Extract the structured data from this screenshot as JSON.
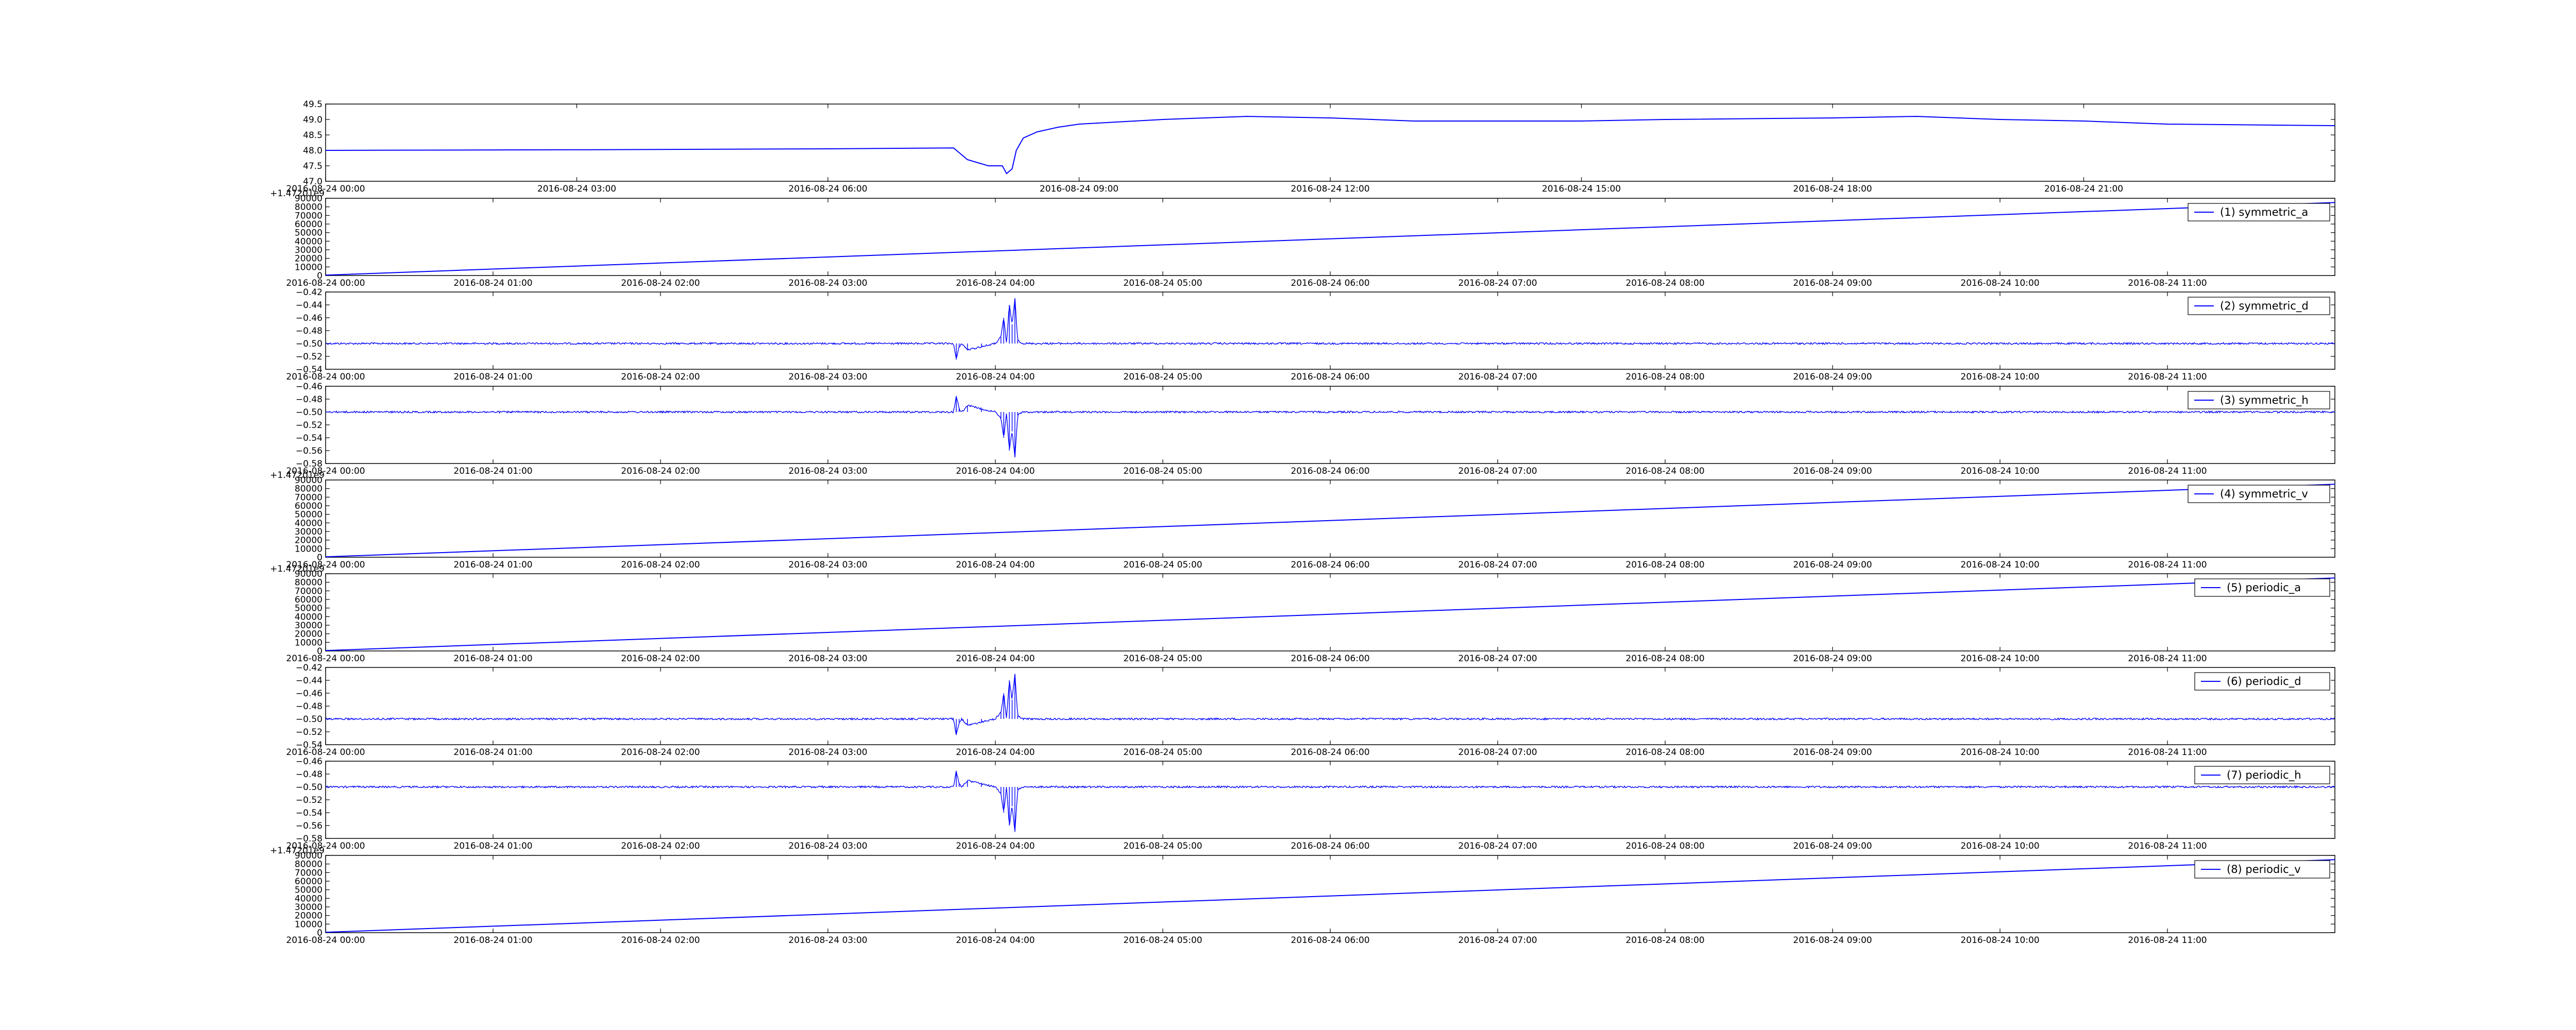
{
  "figure": {
    "background": "#ffffff",
    "line_color": "#0000ff"
  },
  "chart_data": [
    {
      "type": "line",
      "title": "",
      "xlabel": "",
      "ylabel": "",
      "x_range": [
        "2016-08-24 00:00",
        "2016-08-25 00:00"
      ],
      "ylim": [
        47.0,
        49.5
      ],
      "grid": false,
      "x_ticks": [
        "2016-08-24 00:00",
        "2016-08-24 03:00",
        "2016-08-24 06:00",
        "2016-08-24 09:00",
        "2016-08-24 12:00",
        "2016-08-24 15:00",
        "2016-08-24 18:00",
        "2016-08-24 21:00"
      ],
      "y_ticks": [
        "47.0",
        "47.5",
        "48.0",
        "48.5",
        "49.0",
        "49.5"
      ],
      "series": [
        {
          "color": "#0000ff",
          "x": [
            "2016-08-24 00:00",
            "2016-08-24 03:00",
            "2016-08-24 06:00",
            "2016-08-24 07:30",
            "2016-08-24 07:40",
            "2016-08-24 07:55",
            "2016-08-24 08:05",
            "2016-08-24 08:08",
            "2016-08-24 08:12",
            "2016-08-24 08:15",
            "2016-08-24 08:20",
            "2016-08-24 08:30",
            "2016-08-24 08:45",
            "2016-08-24 09:00",
            "2016-08-24 10:00",
            "2016-08-24 11:00",
            "2016-08-24 12:00",
            "2016-08-24 13:00",
            "2016-08-24 15:00",
            "2016-08-24 16:00",
            "2016-08-24 18:00",
            "2016-08-24 19:00",
            "2016-08-24 20:00",
            "2016-08-24 21:00",
            "2016-08-24 22:00",
            "2016-08-25 00:00"
          ],
          "y": [
            48.0,
            48.02,
            48.05,
            48.08,
            47.7,
            47.5,
            47.5,
            47.25,
            47.4,
            48.0,
            48.4,
            48.6,
            48.75,
            48.85,
            49.0,
            49.1,
            49.05,
            48.95,
            48.95,
            49.0,
            49.05,
            49.1,
            49.0,
            48.95,
            48.85,
            48.8
          ]
        }
      ]
    },
    {
      "type": "line",
      "title": "",
      "xlabel": "",
      "ylabel": "",
      "y_offset_label": "+1.47201e9",
      "x_range": [
        "2016-08-24 00:00",
        "2016-08-24 12:00"
      ],
      "ylim": [
        0,
        90000
      ],
      "grid": false,
      "x_ticks": [
        "2016-08-24 00:00",
        "2016-08-24 01:00",
        "2016-08-24 02:00",
        "2016-08-24 03:00",
        "2016-08-24 04:00",
        "2016-08-24 05:00",
        "2016-08-24 06:00",
        "2016-08-24 07:00",
        "2016-08-24 08:00",
        "2016-08-24 09:00",
        "2016-08-24 10:00",
        "2016-08-24 11:00"
      ],
      "y_ticks": [
        "0",
        "10000",
        "20000",
        "30000",
        "40000",
        "50000",
        "60000",
        "70000",
        "80000",
        "90000"
      ],
      "legend_position": "top-right",
      "series": [
        {
          "name": "(1) symmetric_a",
          "color": "#0000ff",
          "x": [
            "2016-08-24 00:00",
            "2016-08-24 12:00"
          ],
          "y": [
            500,
            85000
          ]
        }
      ]
    },
    {
      "type": "line",
      "title": "",
      "xlabel": "",
      "ylabel": "",
      "x_range": [
        "2016-08-24 00:00",
        "2016-08-24 12:00"
      ],
      "ylim": [
        -0.54,
        -0.42
      ],
      "grid": false,
      "x_ticks": [
        "2016-08-24 00:00",
        "2016-08-24 01:00",
        "2016-08-24 02:00",
        "2016-08-24 03:00",
        "2016-08-24 04:00",
        "2016-08-24 05:00",
        "2016-08-24 06:00",
        "2016-08-24 07:00",
        "2016-08-24 08:00",
        "2016-08-24 09:00",
        "2016-08-24 10:00",
        "2016-08-24 11:00"
      ],
      "y_ticks": [
        "-0.54",
        "-0.52",
        "-0.50",
        "-0.48",
        "-0.46",
        "-0.44",
        "-0.42"
      ],
      "legend_position": "top-right",
      "series": [
        {
          "name": "(2) symmetric_d",
          "color": "#0000ff",
          "x": [
            "2016-08-24 00:00",
            "2016-08-24 03:45",
            "2016-08-24 03:46",
            "2016-08-24 03:47",
            "2016-08-24 03:48",
            "2016-08-24 03:50",
            "2016-08-24 03:55",
            "2016-08-24 04:00",
            "2016-08-24 04:02",
            "2016-08-24 04:03",
            "2016-08-24 04:04",
            "2016-08-24 04:05",
            "2016-08-24 04:06",
            "2016-08-24 04:07",
            "2016-08-24 04:08",
            "2016-08-24 04:10",
            "2016-08-24 12:00"
          ],
          "y": [
            -0.5,
            -0.5,
            -0.525,
            -0.505,
            -0.5,
            -0.51,
            -0.505,
            -0.5,
            -0.49,
            -0.46,
            -0.5,
            -0.44,
            -0.47,
            -0.43,
            -0.495,
            -0.5,
            -0.5
          ]
        }
      ]
    },
    {
      "type": "line",
      "title": "",
      "xlabel": "",
      "ylabel": "",
      "x_range": [
        "2016-08-24 00:00",
        "2016-08-24 12:00"
      ],
      "ylim": [
        -0.58,
        -0.46
      ],
      "grid": false,
      "x_ticks": [
        "2016-08-24 00:00",
        "2016-08-24 01:00",
        "2016-08-24 02:00",
        "2016-08-24 03:00",
        "2016-08-24 04:00",
        "2016-08-24 05:00",
        "2016-08-24 06:00",
        "2016-08-24 07:00",
        "2016-08-24 08:00",
        "2016-08-24 09:00",
        "2016-08-24 10:00",
        "2016-08-24 11:00"
      ],
      "y_ticks": [
        "-0.58",
        "-0.56",
        "-0.54",
        "-0.52",
        "-0.50",
        "-0.48",
        "-0.46"
      ],
      "legend_position": "top-right",
      "series": [
        {
          "name": "(3) symmetric_h",
          "color": "#0000ff",
          "x": [
            "2016-08-24 00:00",
            "2016-08-24 03:45",
            "2016-08-24 03:46",
            "2016-08-24 03:47",
            "2016-08-24 03:48",
            "2016-08-24 03:50",
            "2016-08-24 03:55",
            "2016-08-24 04:00",
            "2016-08-24 04:02",
            "2016-08-24 04:03",
            "2016-08-24 04:04",
            "2016-08-24 04:05",
            "2016-08-24 04:06",
            "2016-08-24 04:07",
            "2016-08-24 04:08",
            "2016-08-24 04:10",
            "2016-08-24 12:00"
          ],
          "y": [
            -0.5,
            -0.5,
            -0.475,
            -0.495,
            -0.5,
            -0.49,
            -0.495,
            -0.5,
            -0.51,
            -0.54,
            -0.5,
            -0.56,
            -0.53,
            -0.57,
            -0.505,
            -0.5,
            -0.5
          ]
        }
      ]
    },
    {
      "type": "line",
      "title": "",
      "xlabel": "",
      "ylabel": "",
      "y_offset_label": "+1.47201e9",
      "x_range": [
        "2016-08-24 00:00",
        "2016-08-24 12:00"
      ],
      "ylim": [
        0,
        90000
      ],
      "grid": false,
      "x_ticks": [
        "2016-08-24 00:00",
        "2016-08-24 01:00",
        "2016-08-24 02:00",
        "2016-08-24 03:00",
        "2016-08-24 04:00",
        "2016-08-24 05:00",
        "2016-08-24 06:00",
        "2016-08-24 07:00",
        "2016-08-24 08:00",
        "2016-08-24 09:00",
        "2016-08-24 10:00",
        "2016-08-24 11:00"
      ],
      "y_ticks": [
        "0",
        "10000",
        "20000",
        "30000",
        "40000",
        "50000",
        "60000",
        "70000",
        "80000",
        "90000"
      ],
      "legend_position": "top-right",
      "series": [
        {
          "name": "(4) symmetric_v",
          "color": "#0000ff",
          "x": [
            "2016-08-24 00:00",
            "2016-08-24 12:00"
          ],
          "y": [
            500,
            85000
          ]
        }
      ]
    },
    {
      "type": "line",
      "title": "",
      "xlabel": "",
      "ylabel": "",
      "y_offset_label": "+1.47201e9",
      "x_range": [
        "2016-08-24 00:00",
        "2016-08-24 12:00"
      ],
      "ylim": [
        0,
        90000
      ],
      "grid": false,
      "x_ticks": [
        "2016-08-24 00:00",
        "2016-08-24 01:00",
        "2016-08-24 02:00",
        "2016-08-24 03:00",
        "2016-08-24 04:00",
        "2016-08-24 05:00",
        "2016-08-24 06:00",
        "2016-08-24 07:00",
        "2016-08-24 08:00",
        "2016-08-24 09:00",
        "2016-08-24 10:00",
        "2016-08-24 11:00"
      ],
      "y_ticks": [
        "0",
        "10000",
        "20000",
        "30000",
        "40000",
        "50000",
        "60000",
        "70000",
        "80000",
        "90000"
      ],
      "legend_position": "top-right",
      "series": [
        {
          "name": "(5) periodic_a",
          "color": "#0000ff",
          "x": [
            "2016-08-24 00:00",
            "2016-08-24 12:00"
          ],
          "y": [
            500,
            85000
          ]
        }
      ]
    },
    {
      "type": "line",
      "title": "",
      "xlabel": "",
      "ylabel": "",
      "x_range": [
        "2016-08-24 00:00",
        "2016-08-24 12:00"
      ],
      "ylim": [
        -0.54,
        -0.42
      ],
      "grid": false,
      "x_ticks": [
        "2016-08-24 00:00",
        "2016-08-24 01:00",
        "2016-08-24 02:00",
        "2016-08-24 03:00",
        "2016-08-24 04:00",
        "2016-08-24 05:00",
        "2016-08-24 06:00",
        "2016-08-24 07:00",
        "2016-08-24 08:00",
        "2016-08-24 09:00",
        "2016-08-24 10:00",
        "2016-08-24 11:00"
      ],
      "y_ticks": [
        "-0.54",
        "-0.52",
        "-0.50",
        "-0.48",
        "-0.46",
        "-0.44",
        "-0.42"
      ],
      "legend_position": "top-right",
      "series": [
        {
          "name": "(6) periodic_d",
          "color": "#0000ff",
          "x": [
            "2016-08-24 00:00",
            "2016-08-24 03:45",
            "2016-08-24 03:46",
            "2016-08-24 03:47",
            "2016-08-24 03:48",
            "2016-08-24 03:50",
            "2016-08-24 03:55",
            "2016-08-24 04:00",
            "2016-08-24 04:02",
            "2016-08-24 04:03",
            "2016-08-24 04:04",
            "2016-08-24 04:05",
            "2016-08-24 04:06",
            "2016-08-24 04:07",
            "2016-08-24 04:08",
            "2016-08-24 04:10",
            "2016-08-24 12:00"
          ],
          "y": [
            -0.5,
            -0.5,
            -0.525,
            -0.505,
            -0.5,
            -0.51,
            -0.505,
            -0.5,
            -0.49,
            -0.46,
            -0.5,
            -0.44,
            -0.47,
            -0.43,
            -0.495,
            -0.5,
            -0.5
          ]
        }
      ]
    },
    {
      "type": "line",
      "title": "",
      "xlabel": "",
      "ylabel": "",
      "x_range": [
        "2016-08-24 00:00",
        "2016-08-24 12:00"
      ],
      "ylim": [
        -0.58,
        -0.46
      ],
      "grid": false,
      "x_ticks": [
        "2016-08-24 00:00",
        "2016-08-24 01:00",
        "2016-08-24 02:00",
        "2016-08-24 03:00",
        "2016-08-24 04:00",
        "2016-08-24 05:00",
        "2016-08-24 06:00",
        "2016-08-24 07:00",
        "2016-08-24 08:00",
        "2016-08-24 09:00",
        "2016-08-24 10:00",
        "2016-08-24 11:00"
      ],
      "y_ticks": [
        "-0.58",
        "-0.56",
        "-0.54",
        "-0.52",
        "-0.50",
        "-0.48",
        "-0.46"
      ],
      "legend_position": "top-right",
      "series": [
        {
          "name": "(7) periodic_h",
          "color": "#0000ff",
          "x": [
            "2016-08-24 00:00",
            "2016-08-24 03:45",
            "2016-08-24 03:46",
            "2016-08-24 03:47",
            "2016-08-24 03:48",
            "2016-08-24 03:50",
            "2016-08-24 03:55",
            "2016-08-24 04:00",
            "2016-08-24 04:02",
            "2016-08-24 04:03",
            "2016-08-24 04:04",
            "2016-08-24 04:05",
            "2016-08-24 04:06",
            "2016-08-24 04:07",
            "2016-08-24 04:08",
            "2016-08-24 04:10",
            "2016-08-24 12:00"
          ],
          "y": [
            -0.5,
            -0.5,
            -0.475,
            -0.495,
            -0.5,
            -0.49,
            -0.495,
            -0.5,
            -0.51,
            -0.54,
            -0.5,
            -0.56,
            -0.53,
            -0.57,
            -0.505,
            -0.5,
            -0.5
          ]
        }
      ]
    },
    {
      "type": "line",
      "title": "",
      "xlabel": "",
      "ylabel": "",
      "y_offset_label": "+1.47201e9",
      "x_range": [
        "2016-08-24 00:00",
        "2016-08-24 12:00"
      ],
      "ylim": [
        0,
        90000
      ],
      "grid": false,
      "x_ticks": [
        "2016-08-24 00:00",
        "2016-08-24 01:00",
        "2016-08-24 02:00",
        "2016-08-24 03:00",
        "2016-08-24 04:00",
        "2016-08-24 05:00",
        "2016-08-24 06:00",
        "2016-08-24 07:00",
        "2016-08-24 08:00",
        "2016-08-24 09:00",
        "2016-08-24 10:00",
        "2016-08-24 11:00"
      ],
      "y_ticks": [
        "0",
        "10000",
        "20000",
        "30000",
        "40000",
        "50000",
        "60000",
        "70000",
        "80000",
        "90000"
      ],
      "legend_position": "top-right",
      "series": [
        {
          "name": "(8) periodic_v",
          "color": "#0000ff",
          "x": [
            "2016-08-24 00:00",
            "2016-08-24 12:00"
          ],
          "y": [
            500,
            85000
          ]
        }
      ]
    }
  ]
}
